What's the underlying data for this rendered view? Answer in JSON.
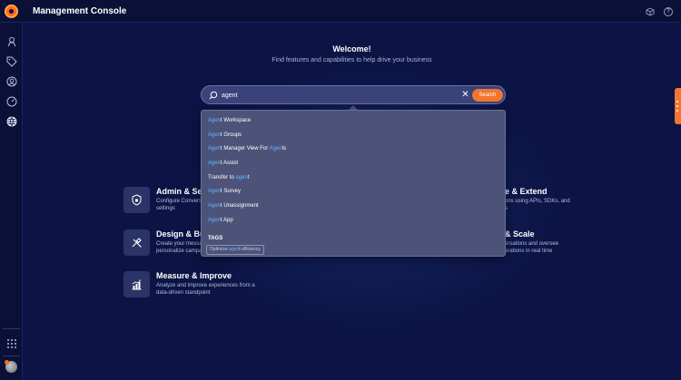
{
  "app": {
    "title": "Management Console"
  },
  "welcome": {
    "title": "Welcome!",
    "subtitle": "Find features and capabilities to help drive your business"
  },
  "search": {
    "value": "agent",
    "button_label": "Search"
  },
  "suggestions": [
    {
      "match": "Agen",
      "rest": "t Workspace"
    },
    {
      "match": "Agen",
      "rest": "t Groups"
    },
    {
      "match": "Agen",
      "rest": "t Manager View For ",
      "match2": "Agen",
      "rest2": "ts"
    },
    {
      "match": "Agen",
      "rest": "t Assist"
    },
    {
      "prefix": "Transfer to ",
      "match": "agen",
      "rest": "t"
    },
    {
      "match": "Agen",
      "rest": "t Survey"
    },
    {
      "match": "Agen",
      "rest": "t Unassignment"
    },
    {
      "match": "Agen",
      "rest": "t App"
    }
  ],
  "tags": {
    "heading": "TAGS",
    "items": [
      {
        "prefix": "Optimize ",
        "match": "agen",
        "rest": "t efficiency"
      }
    ]
  },
  "cards": [
    {
      "title": "Admin & Sec",
      "desc_line1": "Configure Convers",
      "desc_line2": "settings",
      "icon": "shield-icon"
    },
    {
      "title": "Design & Bui",
      "desc_line1": "Create your messa",
      "desc_line2": "personalize campa",
      "icon": "tools-icon"
    },
    {
      "title": "Measure & Improve",
      "desc_line1": "Analyze and improve experiences from a",
      "desc_line2": "data-driven standpoint",
      "icon": "chart-icon"
    },
    {
      "title": "e & Extend",
      "desc_line1": "ons using APIs, SDKs, and",
      "desc_line2": "s",
      "icon": ""
    },
    {
      "title": "& Scale",
      "desc_line1": "ersations and oversee",
      "desc_line2": "erations in real time",
      "icon": ""
    }
  ],
  "colors": {
    "background": "#0b1445",
    "accent": "#f2762e",
    "highlight": "#5fb4ff"
  }
}
